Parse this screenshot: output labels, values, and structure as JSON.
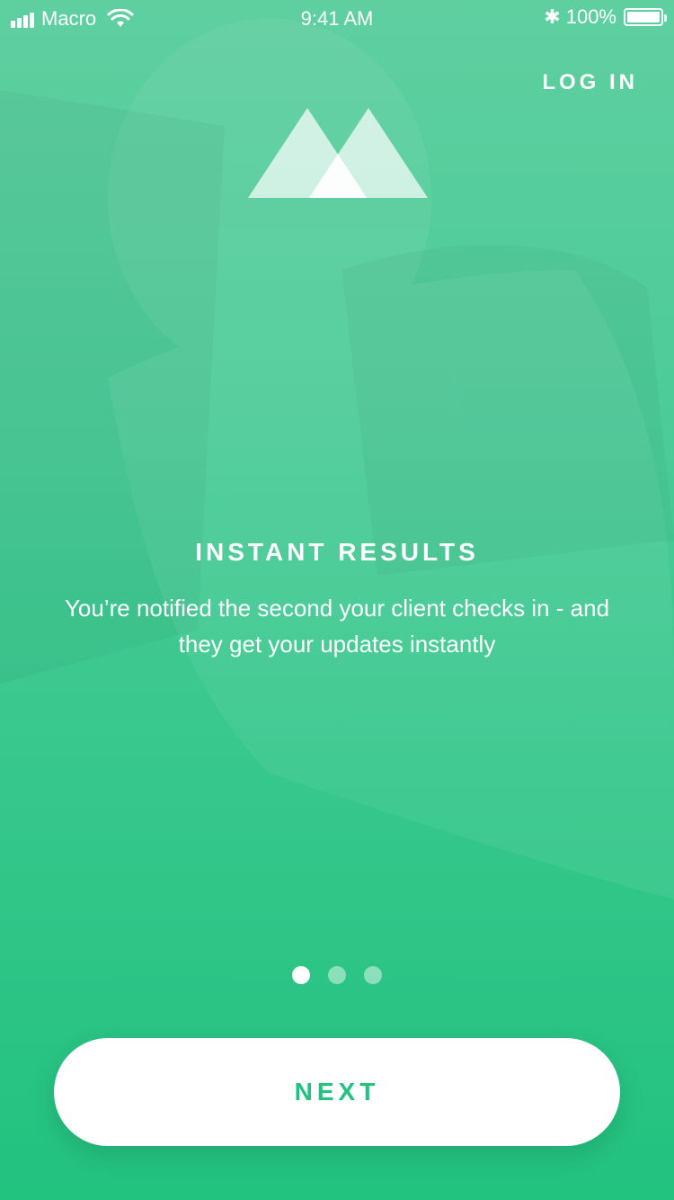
{
  "status_bar": {
    "carrier": "Macro",
    "time": "9:41 AM",
    "battery": "100%",
    "icons": [
      "signal-icon",
      "wifi-icon",
      "bluetooth-icon",
      "battery-icon"
    ]
  },
  "header": {
    "login_label": "LOG IN",
    "logo_icon": "mountain-logo-icon"
  },
  "onboarding": {
    "title": "INSTANT RESULTS",
    "description": "You’re notified the second your client checks in - and they get your updates instantly",
    "page_count": 3,
    "current_page": 1
  },
  "footer": {
    "next_label": "NEXT"
  },
  "colors": {
    "background_top": "#5fcfa0",
    "background_bottom": "#22c27f",
    "accent": "#22c27f",
    "text": "#ffffff"
  }
}
